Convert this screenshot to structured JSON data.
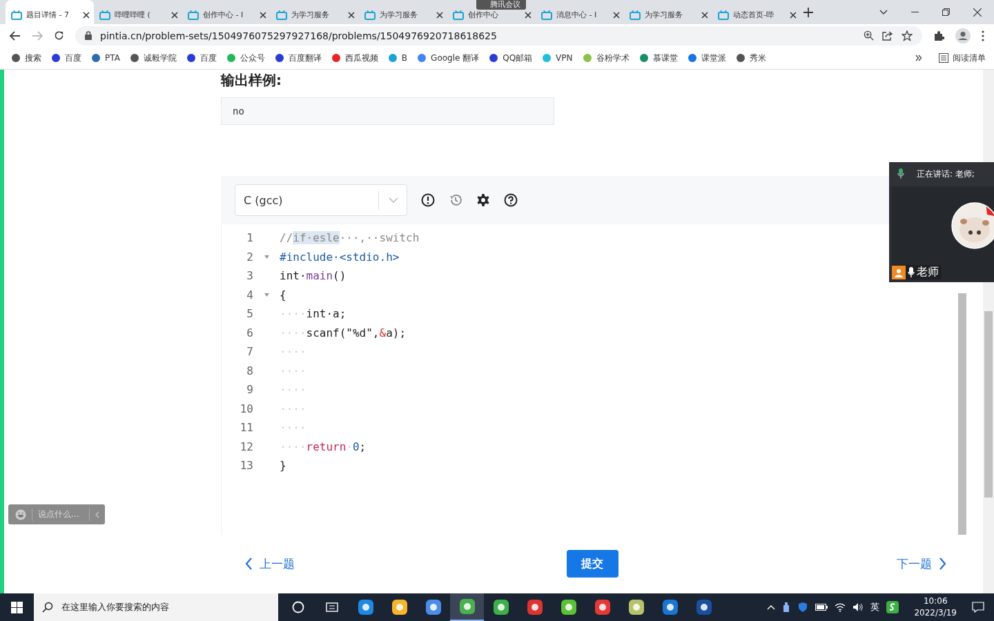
{
  "browser": {
    "tabs": [
      {
        "title": "题目详情 - 7",
        "selected": true
      },
      {
        "title": "哔哩哔哩 (",
        "selected": false
      },
      {
        "title": "创作中心 - I",
        "selected": false
      },
      {
        "title": "为学习服务",
        "selected": false
      },
      {
        "title": "为学习服务",
        "selected": false
      },
      {
        "title": "创作中心",
        "selected": false
      },
      {
        "title": "消息中心 - I",
        "selected": false
      },
      {
        "title": "为学习服务",
        "selected": false
      },
      {
        "title": "动态首页-哔",
        "selected": false
      }
    ],
    "address": "pintia.cn/problem-sets/1504976075297927168/problems/1504976920718618625",
    "bookmarks": [
      {
        "label": "搜索"
      },
      {
        "label": "百度"
      },
      {
        "label": "PTA"
      },
      {
        "label": "诚毅学院"
      },
      {
        "label": "百度"
      },
      {
        "label": "公众号"
      },
      {
        "label": "百度翻译"
      },
      {
        "label": "西瓜视频"
      },
      {
        "label": "B"
      },
      {
        "label": "Google 翻译"
      },
      {
        "label": "QQ邮箱"
      },
      {
        "label": "VPN"
      },
      {
        "label": "谷粉学术"
      },
      {
        "label": "慕课堂"
      },
      {
        "label": "课堂派"
      },
      {
        "label": "秀米"
      }
    ],
    "reading_list": "阅读清单"
  },
  "meeting_badge": "腾讯会议",
  "page": {
    "section_title": "输出样例:",
    "sample_output": "no",
    "editor": {
      "language": "C (gcc)",
      "lines": [
        {
          "number": "1",
          "fold": false,
          "segments": [
            {
              "text": "//",
              "kind": "comment"
            },
            {
              "text": "if·esle",
              "kind": "selection"
            },
            {
              "text": "···,··switch",
              "kind": "comment"
            }
          ]
        },
        {
          "number": "2",
          "fold": true,
          "segments": [
            {
              "text": "#include·<stdio.h>",
              "kind": "directive"
            }
          ]
        },
        {
          "number": "3",
          "fold": false,
          "segments": [
            {
              "text": "int·",
              "kind": "plain"
            },
            {
              "text": "main",
              "kind": "function"
            },
            {
              "text": "()",
              "kind": "plain"
            }
          ]
        },
        {
          "number": "4",
          "fold": true,
          "segments": [
            {
              "text": "{",
              "kind": "plain"
            }
          ]
        },
        {
          "number": "5",
          "fold": false,
          "segments": [
            {
              "text": "····",
              "kind": "space"
            },
            {
              "text": "int·a;",
              "kind": "plain"
            }
          ]
        },
        {
          "number": "6",
          "fold": false,
          "segments": [
            {
              "text": "····",
              "kind": "space"
            },
            {
              "text": "scanf(\"%d\",",
              "kind": "plain"
            },
            {
              "text": "&",
              "kind": "operator"
            },
            {
              "text": "a);",
              "kind": "plain"
            }
          ]
        },
        {
          "number": "7",
          "fold": false,
          "segments": [
            {
              "text": "····",
              "kind": "space"
            }
          ]
        },
        {
          "number": "8",
          "fold": false,
          "segments": [
            {
              "text": "····",
              "kind": "space"
            }
          ]
        },
        {
          "number": "9",
          "fold": false,
          "segments": [
            {
              "text": "····",
              "kind": "space"
            }
          ]
        },
        {
          "number": "10",
          "fold": false,
          "segments": [
            {
              "text": "····",
              "kind": "space"
            }
          ]
        },
        {
          "number": "11",
          "fold": false,
          "segments": [
            {
              "text": "····",
              "kind": "space"
            }
          ]
        },
        {
          "number": "12",
          "fold": false,
          "segments": [
            {
              "text": "····",
              "kind": "space"
            },
            {
              "text": "return",
              "kind": "keyword"
            },
            {
              "text": "·",
              "kind": "space"
            },
            {
              "text": "0",
              "kind": "number"
            },
            {
              "text": ";",
              "kind": "plain"
            }
          ]
        },
        {
          "number": "13",
          "fold": false,
          "segments": [
            {
              "text": "}",
              "kind": "plain"
            }
          ]
        }
      ]
    },
    "prev": "上一题",
    "submit": "提交",
    "next": "下一题"
  },
  "meeting": {
    "speaking": "正在讲话: 老师;",
    "participant": "老师"
  },
  "chat": {
    "placeholder": "说点什么..."
  },
  "taskbar": {
    "search_placeholder": "在这里输入你要搜索的内容",
    "apps": [
      {
        "selected": false
      },
      {
        "selected": false
      },
      {
        "selected": false
      },
      {
        "selected": false
      },
      {
        "selected": false
      },
      {
        "selected": true
      },
      {
        "selected": false
      },
      {
        "selected": false
      },
      {
        "selected": false
      },
      {
        "selected": false
      },
      {
        "selected": false
      },
      {
        "selected": false
      },
      {
        "selected": false
      }
    ],
    "ime": "英",
    "time": "10:06",
    "date": "2022/3/19"
  }
}
